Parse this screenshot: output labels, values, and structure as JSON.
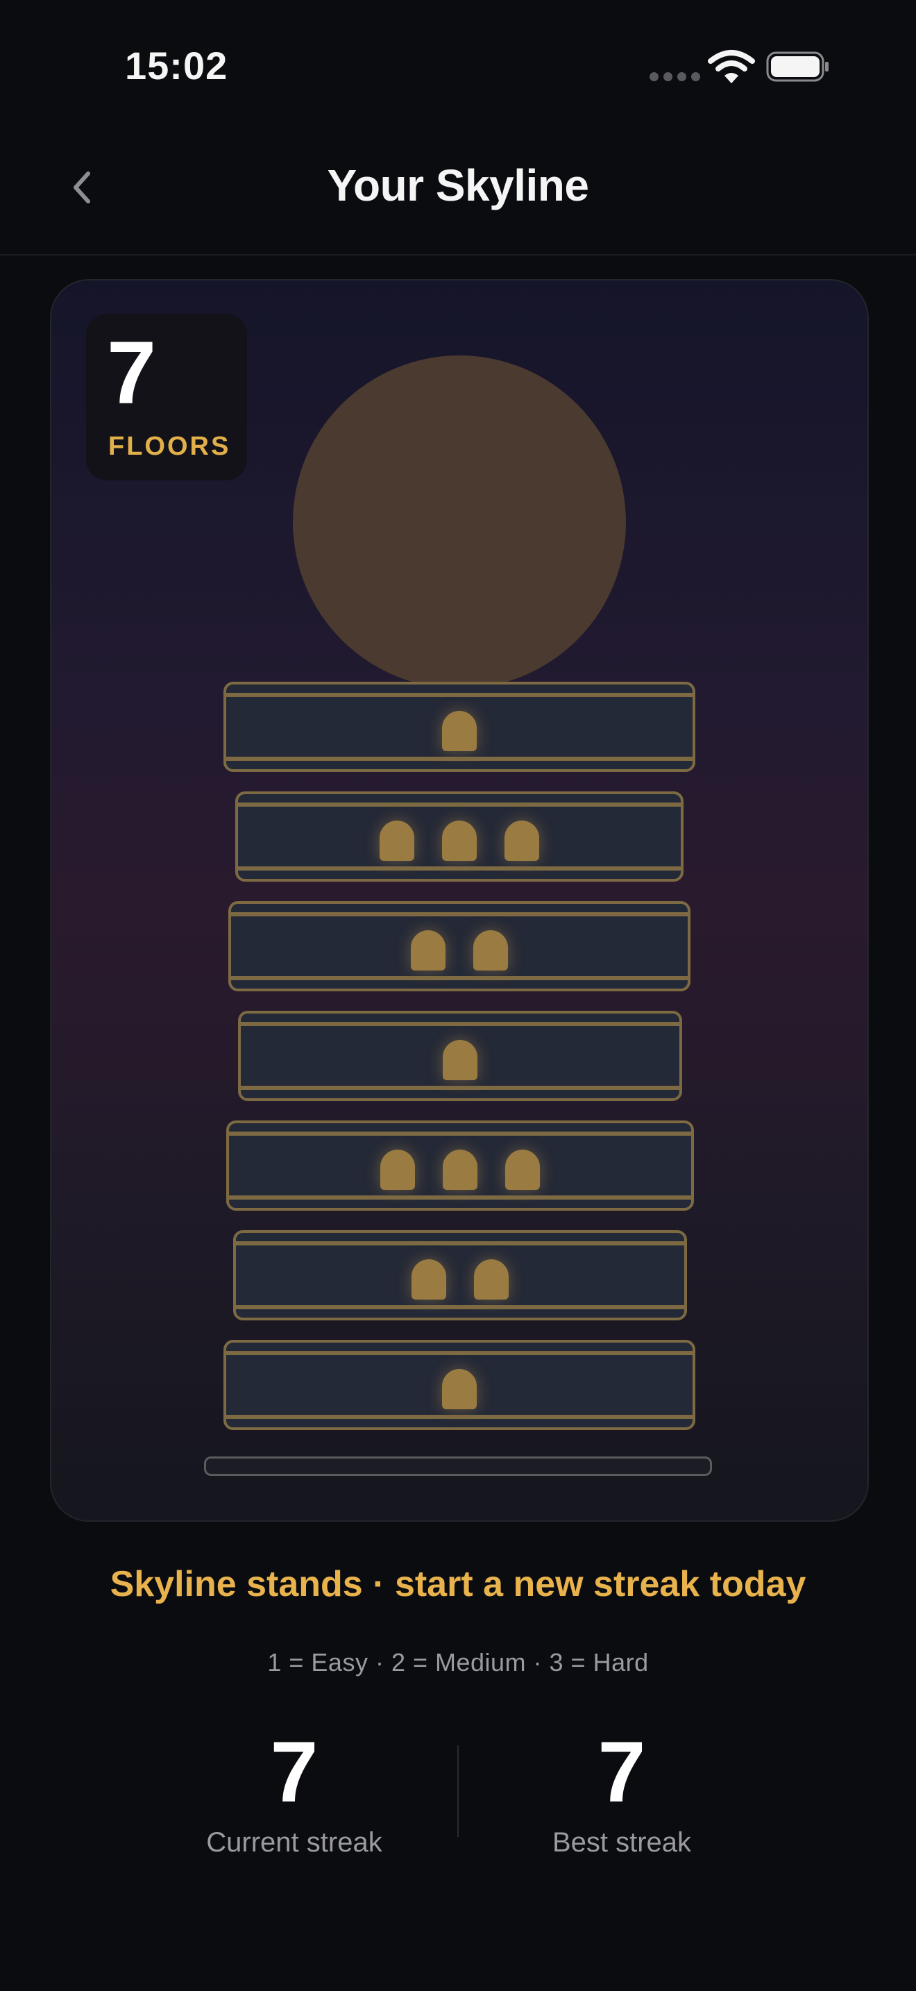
{
  "status_bar": {
    "time": "15:02"
  },
  "nav": {
    "title": "Your Skyline"
  },
  "card": {
    "floor_count": "7",
    "floor_label": "FLOORS",
    "floors": [
      {
        "level": 7,
        "difficulty": 1
      },
      {
        "level": 6,
        "difficulty": 3
      },
      {
        "level": 5,
        "difficulty": 2
      },
      {
        "level": 4,
        "difficulty": 1
      },
      {
        "level": 3,
        "difficulty": 3
      },
      {
        "level": 2,
        "difficulty": 2
      },
      {
        "level": 1,
        "difficulty": 1
      }
    ]
  },
  "message": "Skyline stands · start a new streak today",
  "legend": "1 = Easy · 2 = Medium · 3 = Hard",
  "stats": {
    "current": {
      "value": "7",
      "label": "Current streak"
    },
    "best": {
      "value": "7",
      "label": "Best streak"
    }
  },
  "colors": {
    "accent": "#e2b04a",
    "window": "#9a7c43",
    "floor_border": "#7d6a43",
    "floor_fill": "#242937"
  }
}
